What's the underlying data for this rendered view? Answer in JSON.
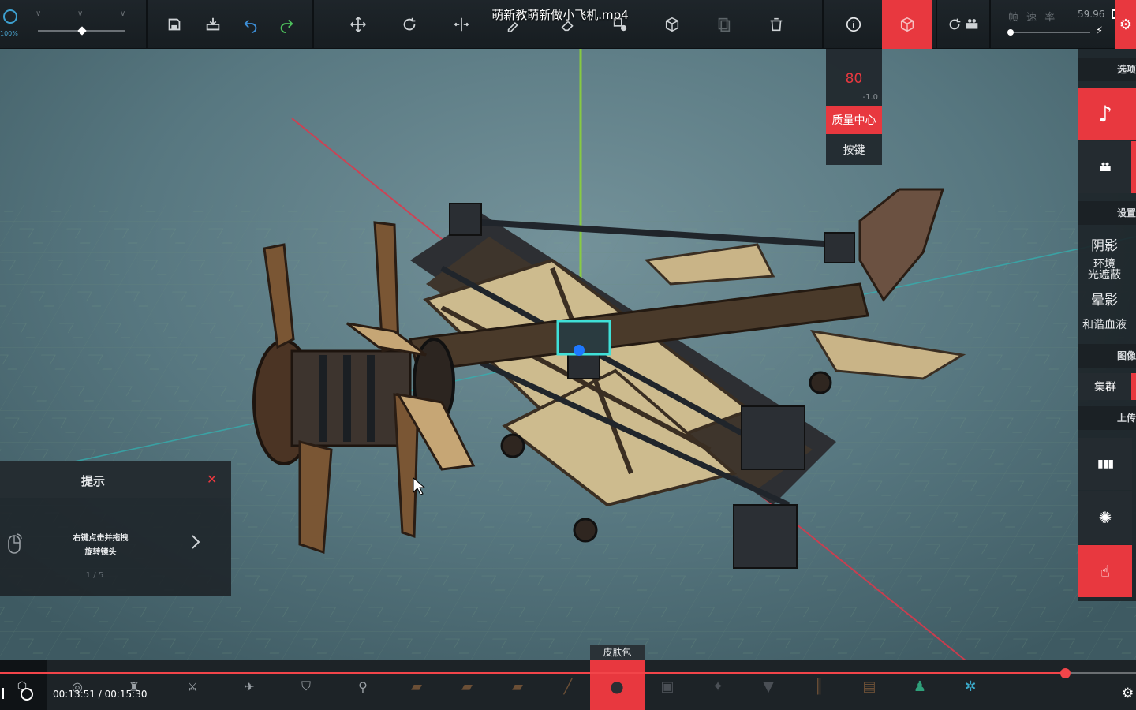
{
  "video": {
    "title": "萌新教萌新做小飞机.mp4",
    "current_time": "00:13:51",
    "duration": "00:15:30",
    "progress": 0.9375
  },
  "toolbar": {
    "zoom": "100%",
    "fps_label": "帧 速 率",
    "fps_value": "59.96",
    "buttons": [
      "save-icon",
      "load-icon",
      "undo-icon",
      "redo-icon",
      "move-icon",
      "rotate-icon",
      "mirror-icon",
      "pipette-icon",
      "eraser-icon",
      "multiselect-icon",
      "view-box-icon",
      "copy-icon",
      "delete-icon",
      "info-icon",
      "center-box-icon",
      "camera-refresh-icon",
      "camera-icon",
      "speed-icon",
      "settings-gear-icon"
    ]
  },
  "center_of_mass_panel": {
    "value": "80",
    "sub": "-1.0",
    "mass_center_label": "质量中心",
    "keys_label": "按键"
  },
  "right_panel": {
    "options_header": "选项",
    "settings_header": "设置",
    "shadow_label": "阴影",
    "ao_label_line1": "环境",
    "ao_label_line2": "光遮蔽",
    "bloom_label": "晕影",
    "blood_label": "和谐血液",
    "graphics_header": "图像",
    "cluster_label": "集群",
    "upload_header": "上传"
  },
  "hint": {
    "title": "提示",
    "line1": "右键点击并拖拽",
    "line2": "旋转镜头",
    "page": "1 / 5"
  },
  "bottom": {
    "skin_tab": "皮肤包"
  },
  "colors": {
    "accent": "#e8383f",
    "toolbar_bg": "#1b2125",
    "sky": "#4f6f7a"
  }
}
